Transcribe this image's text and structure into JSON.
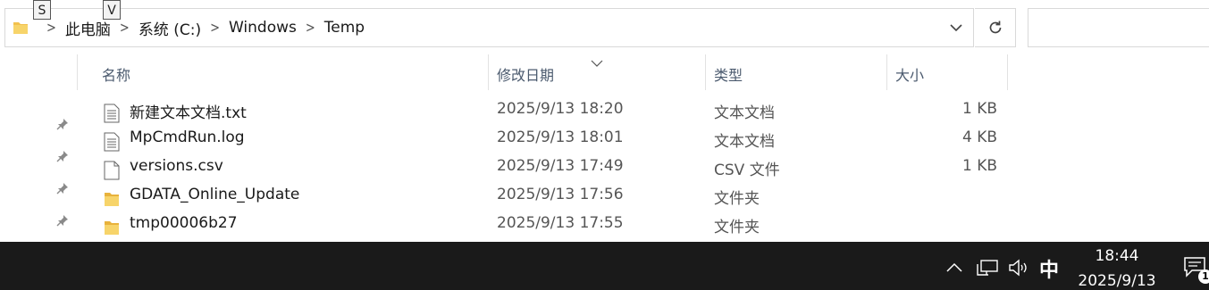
{
  "shortcut_keys": [
    "S",
    "V"
  ],
  "breadcrumb": [
    "此电脑",
    "系统 (C:)",
    "Windows",
    "Temp"
  ],
  "columns": {
    "name": "名称",
    "date": "修改日期",
    "type": "类型",
    "size": "大小"
  },
  "files": [
    {
      "name": "新建文本文档.txt",
      "date": "2025/9/13 18:20",
      "type": "文本文档",
      "size": "1 KB",
      "icon": "text-file-icon"
    },
    {
      "name": "MpCmdRun.log",
      "date": "2025/9/13 18:01",
      "type": "文本文档",
      "size": "4 KB",
      "icon": "text-file-icon"
    },
    {
      "name": "versions.csv",
      "date": "2025/9/13 17:49",
      "type": "CSV 文件",
      "size": "1 KB",
      "icon": "blank-file-icon"
    },
    {
      "name": "GDATA_Online_Update",
      "date": "2025/9/13 17:56",
      "type": "文件夹",
      "size": "",
      "icon": "folder-icon"
    },
    {
      "name": "tmp00006b27",
      "date": "2025/9/13 17:55",
      "type": "文件夹",
      "size": "",
      "icon": "folder-icon"
    }
  ],
  "taskbar": {
    "ime": "中",
    "time": "18:44",
    "date": "2025/9/13",
    "notification_count": "1"
  },
  "colors": {
    "taskbar": "#1a1a1a",
    "folder": "#f2c14e",
    "header_text": "#4b5a6e"
  }
}
